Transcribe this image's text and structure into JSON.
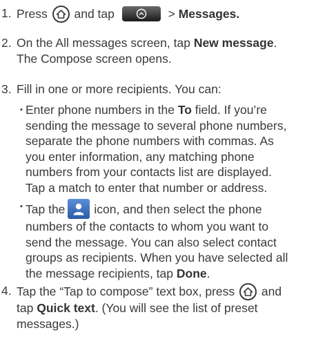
{
  "steps": [
    {
      "number": "1.",
      "press": "Press",
      "and_tap": "and tap",
      "gt": ">",
      "target": "Messages."
    },
    {
      "number": "2.",
      "pre": "On the All messages screen, tap ",
      "bold": "New message",
      "post": ".",
      "line2": "The Compose screen opens."
    },
    {
      "number": "3.",
      "intro": "Fill in one or more recipients. You can:",
      "bullet1": {
        "line1_pre": "Enter phone numbers in the ",
        "line1_bold": "To",
        "line1_post": " field. If you’re",
        "line2": "sending the message to several phone numbers,",
        "line3": "separate the phone numbers with commas. As",
        "line4": "you enter information, any matching phone",
        "line5": "numbers from your contacts list are displayed.",
        "line6": "Tap a match to enter that number or address."
      },
      "bullet2": {
        "line1_pre": "Tap the",
        "line1_post": "icon, and then select the phone",
        "line2": "numbers of the contacts to whom you want to",
        "line3": "send the message. You can also select contact",
        "line4": "groups as recipients. When you have selected all",
        "line5_pre": "the message recipients, tap ",
        "line5_bold": "Done",
        "line5_post": "."
      }
    },
    {
      "number": "4.",
      "line1_pre": "Tap the “Tap to compose” text box, press",
      "line1_post": "and",
      "line2_pre": "tap ",
      "line2_bold": "Quick text",
      "line2_post": ". (You will see the list of preset",
      "line3": "messages.)"
    }
  ],
  "bullet_glyph": "▪",
  "icons": [
    "home-icon",
    "menu-key-icon",
    "contact-person-icon"
  ]
}
